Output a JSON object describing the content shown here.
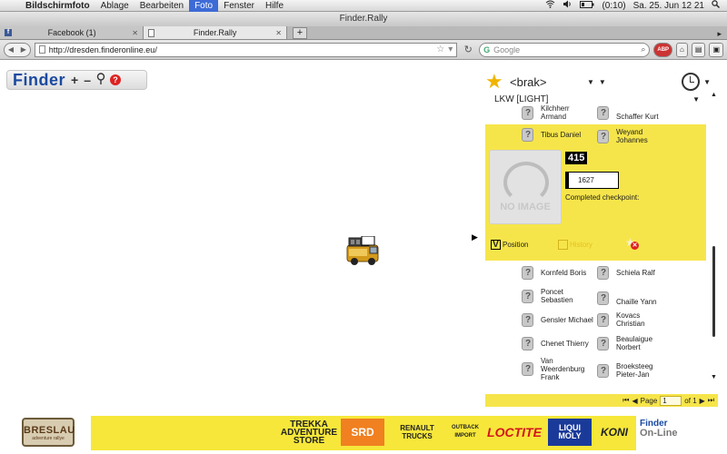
{
  "menubar": {
    "app": "Bildschirmfoto",
    "items": [
      "Ablage",
      "Bearbeiten",
      "Foto",
      "Fenster",
      "Hilfe"
    ],
    "battery": "(0:10)",
    "clock": "Sa. 25. Jun  12 21"
  },
  "window": {
    "title": "Finder.Rally"
  },
  "tabs": [
    {
      "label": "Facebook (1)"
    },
    {
      "label": "Finder.Rally"
    }
  ],
  "nav": {
    "url": "http://dresden.finderonline.eu/",
    "search_placeholder": "Google",
    "search_engine": "G"
  },
  "app": {
    "logo": "Finder",
    "zoom_in": "+",
    "zoom_out": "–",
    "help": "?"
  },
  "panel": {
    "team": "<brak>",
    "class_name": "LKW [LIGHT]",
    "people_top": [
      {
        "name": "Kilchherr\nArmand"
      },
      {
        "name": "Schaffer Kurt"
      },
      {
        "name": "Tibus Daniel"
      },
      {
        "name": "Weyand\nJohannes"
      }
    ],
    "selected": {
      "number": "415",
      "value": "1627",
      "no_image": "NO IMAGE",
      "checkpoint_label": "Completed checkpoint:",
      "position_label": "Position",
      "position_checked": true,
      "history_label": "History",
      "history_checked": false
    },
    "people_bottom": [
      {
        "name": "Kornfeld Boris"
      },
      {
        "name": "Schiela Ralf"
      },
      {
        "name": "Poncet\nSebastien"
      },
      {
        "name": "Chaille Yann"
      },
      {
        "name": "Gensler Michael"
      },
      {
        "name": "Kovacs\nChristian"
      },
      {
        "name": "Chenet Thierry"
      },
      {
        "name": "Beaulaigue\nNorbert"
      },
      {
        "name": "Van\nWeerdenburg\nFrank"
      },
      {
        "name": "Broeksteeg\nPieter-Jan"
      }
    ],
    "pager": {
      "page_label": "Page",
      "page": "1",
      "of_label": "of 1"
    }
  },
  "footer": {
    "breslau": "BRESLAU",
    "breslau_sub": "adventure rallye",
    "sponsors": [
      "TREKKA ADVENTURE STORE",
      "SRD",
      "RENAULT TRUCKS",
      "OUTBACK IMPORT",
      "LOCTITE",
      "LIQUI MOLY",
      "KONI"
    ],
    "finder_online_1": "Finder",
    "finder_online_2": "On-Line"
  },
  "colors": {
    "panel_yellow": "#f6e54a",
    "banner_yellow": "#f6e73a",
    "brand_blue": "#1a4aa0"
  }
}
